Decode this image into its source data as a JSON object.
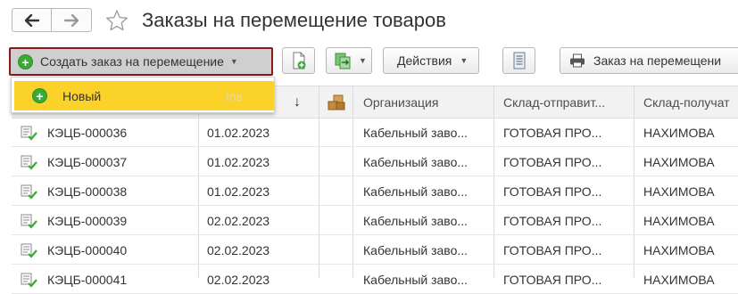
{
  "window": {
    "title": "Заказы на перемещение товаров"
  },
  "toolbar": {
    "create_label": "Создать заказ на перемещение",
    "actions_label": "Действия",
    "print_label": "Заказ на перемещени"
  },
  "dropdown": {
    "item_label": "Новый",
    "item_shortcut": "Ins"
  },
  "table": {
    "columns": {
      "sort_arrow": "↓",
      "organization": "Организация",
      "warehouse_from": "Склад-отправит...",
      "warehouse_to": "Склад-получат"
    },
    "rows": [
      {
        "number": "КЭЦБ-000036",
        "date": "01.02.2023",
        "organization": "Кабельный заво...",
        "warehouse_from": "ГОТОВАЯ ПРО...",
        "warehouse_to": "НАХИМОВА"
      },
      {
        "number": "КЭЦБ-000037",
        "date": "01.02.2023",
        "organization": "Кабельный заво...",
        "warehouse_from": "ГОТОВАЯ ПРО...",
        "warehouse_to": "НАХИМОВА"
      },
      {
        "number": "КЭЦБ-000038",
        "date": "01.02.2023",
        "organization": "Кабельный заво...",
        "warehouse_from": "ГОТОВАЯ ПРО...",
        "warehouse_to": "НАХИМОВА"
      },
      {
        "number": "КЭЦБ-000039",
        "date": "02.02.2023",
        "organization": "Кабельный заво...",
        "warehouse_from": "ГОТОВАЯ ПРО...",
        "warehouse_to": "НАХИМОВА"
      },
      {
        "number": "КЭЦБ-000040",
        "date": "02.02.2023",
        "organization": "Кабельный заво...",
        "warehouse_from": "ГОТОВАЯ ПРО...",
        "warehouse_to": "НАХИМОВА"
      },
      {
        "number": "КЭЦБ-000041",
        "date": "02.02.2023",
        "organization": "Кабельный заво...",
        "warehouse_from": "ГОТОВАЯ ПРО...",
        "warehouse_to": "НАХИМОВА"
      }
    ]
  },
  "colors": {
    "highlight": "#fbd22a",
    "create_border": "#8c1717",
    "green_icon": "#3aaa35",
    "header_bg": "#f2f2f2"
  }
}
